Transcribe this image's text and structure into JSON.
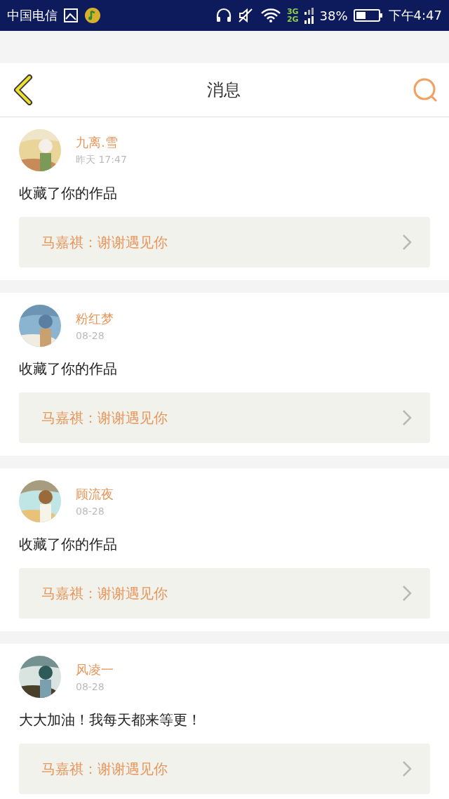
{
  "status_bar": {
    "carrier": "中国电信",
    "network_top": "3G",
    "network_bottom": "2G",
    "battery": "38%",
    "time": "下午4:47"
  },
  "header": {
    "title": "消息"
  },
  "messages": [
    {
      "name": "九离.雪",
      "time": "昨天 17:47",
      "content": "收藏了你的作品",
      "reply": "马嘉祺：谢谢遇见你"
    },
    {
      "name": "粉红梦",
      "time": "08-28",
      "content": "收藏了你的作品",
      "reply": "马嘉祺：谢谢遇见你"
    },
    {
      "name": "顾流夜",
      "time": "08-28",
      "content": "收藏了你的作品",
      "reply": "马嘉祺：谢谢遇见你"
    },
    {
      "name": "风凌一",
      "time": "08-28",
      "content": "大大加油！我每天都来等更！",
      "reply": "马嘉祺：谢谢遇见你"
    }
  ]
}
